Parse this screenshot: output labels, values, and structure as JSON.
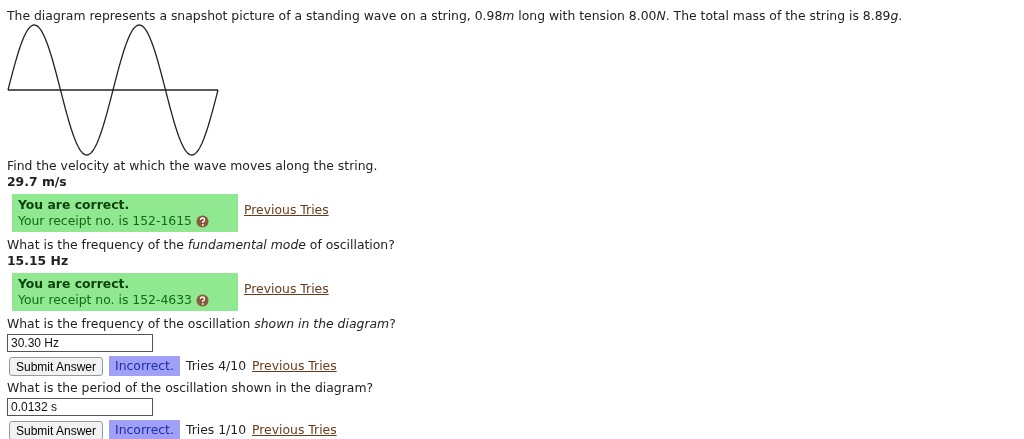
{
  "intro": [
    {
      "text": "The diagram represents a snapshot picture of a standing wave on a string, 0.98",
      "italic": false
    },
    {
      "text": "m",
      "italic": true
    },
    {
      "text": " long with tension 8.00",
      "italic": false
    },
    {
      "text": "N",
      "italic": true
    },
    {
      "text": ". The total mass of the string is 8.89",
      "italic": false
    },
    {
      "text": "g",
      "italic": true
    },
    {
      "text": ".",
      "italic": false
    }
  ],
  "questions": [
    {
      "kind": "answered",
      "prompt": "Find the velocity at which the wave moves along the string.",
      "answer": "29.7 m/s",
      "result": "You are correct.",
      "receipt": "Your receipt no. is 152-1615",
      "link": "Previous Tries"
    },
    {
      "kind": "answered",
      "prompt": "What is the frequency of the *fundamental mode* of oscillation?",
      "answer": "15.15 Hz",
      "result": "You are correct.",
      "receipt": "Your receipt no. is 152-4633",
      "link": "Previous Tries"
    },
    {
      "kind": "open",
      "prompt": "What is the frequency of the oscillation *shown in the diagram*?",
      "value": "30.30 Hz",
      "button": "Submit Answer",
      "result": "Incorrect.",
      "tries": "Tries 4/10",
      "link": "Previous Tries"
    },
    {
      "kind": "open",
      "prompt": "What is the period of the oscillation shown in the diagram?",
      "value": "0.0132 s",
      "button": "Submit Answer",
      "result": "Incorrect.",
      "tries": "Tries 1/10",
      "link": "Previous Tries"
    }
  ]
}
